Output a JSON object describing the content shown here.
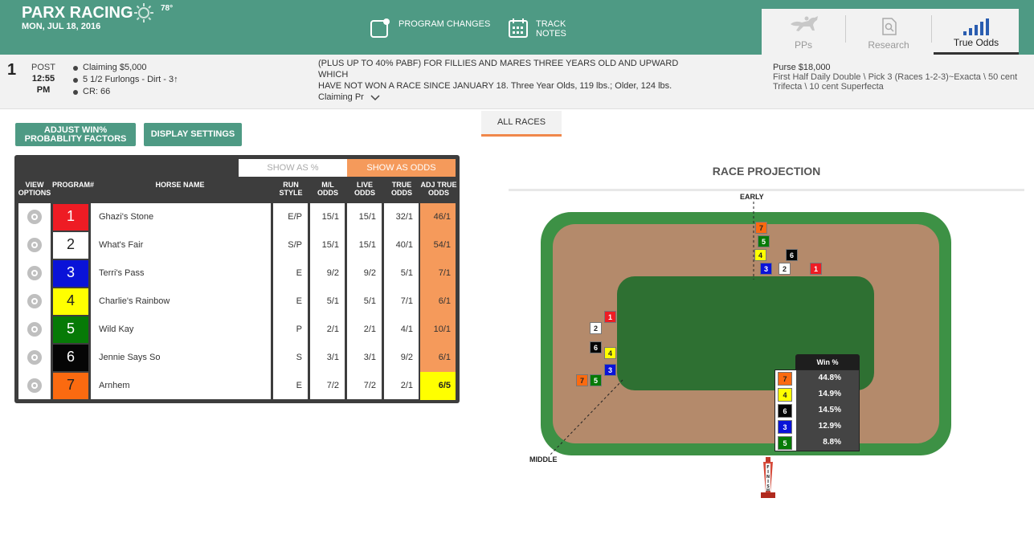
{
  "header": {
    "track": "PARX RACING",
    "date": "MON, JUL 18, 2016",
    "temperature": "78°",
    "weather_icon": "sun-icon",
    "program_changes": "PROGRAM CHANGES",
    "track_notes_1": "TRACK",
    "track_notes_2": "NOTES",
    "tabs": [
      {
        "label": "PPs",
        "icon": "horse-icon"
      },
      {
        "label": "Research",
        "icon": "document-icon"
      },
      {
        "label": "True Odds",
        "icon": "bar-chart-icon",
        "active": true
      }
    ]
  },
  "race": {
    "number": "1",
    "post_label": "POST",
    "post_time": "12:55",
    "post_ampm": "PM",
    "conditions": [
      "Claiming $5,000",
      "5 1/2 Furlongs - Dirt - 3↑",
      "CR: 66"
    ],
    "description_1": "(PLUS UP TO 40% PABF) FOR FILLIES AND MARES THREE YEARS OLD AND UPWARD WHICH",
    "description_2": "HAVE NOT WON A RACE SINCE JANUARY 18. Three Year Olds, 119 lbs.; Older, 124 lbs.",
    "description_3": "Claiming Pr",
    "purse": "Purse $18,000",
    "wagers_1": "First Half Daily Double \\ Pick 3 (Races 1-2-3)~Exacta \\ 50 cent",
    "wagers_2": "Trifecta \\ 10 cent Superfecta"
  },
  "controls": {
    "adjust_1": "ADJUST WIN%",
    "adjust_2": "PROBABLITY FACTORS",
    "display_settings": "DISPLAY SETTINGS",
    "all_races": "ALL RACES",
    "show_pct": "SHOW AS %",
    "show_odds": "SHOW AS ODDS"
  },
  "columns": {
    "view_1": "VIEW",
    "view_2": "OPTIONS",
    "program": "PROGRAM#",
    "horse": "HORSE NAME",
    "run_1": "RUN",
    "run_2": "STYLE",
    "ml_1": "M/L",
    "ml_2": "ODDS",
    "live_1": "LIVE",
    "live_2": "ODDS",
    "true_1": "TRUE",
    "true_2": "ODDS",
    "adj_1": "ADJ TRUE",
    "adj_2": "ODDS"
  },
  "horses": [
    {
      "pp": "1",
      "name": "Ghazi's Stone",
      "style": "E/P",
      "ml": "15/1",
      "live": "15/1",
      "true": "32/1",
      "adj": "46/1",
      "bg": "#ee1c24",
      "fg": "#ffffff"
    },
    {
      "pp": "2",
      "name": "What's Fair",
      "style": "S/P",
      "ml": "15/1",
      "live": "15/1",
      "true": "40/1",
      "adj": "54/1",
      "bg": "#ffffff",
      "fg": "#222222"
    },
    {
      "pp": "3",
      "name": "Terri's Pass",
      "style": "E",
      "ml": "9/2",
      "live": "9/2",
      "true": "5/1",
      "adj": "7/1",
      "bg": "#0a13d8",
      "fg": "#ffffff"
    },
    {
      "pp": "4",
      "name": "Charlie's Rainbow",
      "style": "E",
      "ml": "5/1",
      "live": "5/1",
      "true": "7/1",
      "adj": "6/1",
      "bg": "#ffff00",
      "fg": "#222222"
    },
    {
      "pp": "5",
      "name": "Wild Kay",
      "style": "P",
      "ml": "2/1",
      "live": "2/1",
      "true": "4/1",
      "adj": "10/1",
      "bg": "#067a06",
      "fg": "#ffffff"
    },
    {
      "pp": "6",
      "name": "Jennie Says So",
      "style": "S",
      "ml": "3/1",
      "live": "3/1",
      "true": "9/2",
      "adj": "6/1",
      "bg": "#050505",
      "fg": "#ffffff"
    },
    {
      "pp": "7",
      "name": "Arnhem",
      "style": "E",
      "ml": "7/2",
      "live": "7/2",
      "true": "2/1",
      "adj": "6/5",
      "bg": "#fb6a10",
      "fg": "#222222",
      "best": true
    }
  ],
  "projection": {
    "title": "RACE PROJECTION",
    "early": "EARLY",
    "middle": "MIDDLE",
    "finish": "FINISH",
    "win_header": "Win %",
    "win_table": [
      {
        "pp": "7",
        "pct": "44.8%"
      },
      {
        "pp": "4",
        "pct": "14.9%"
      },
      {
        "pp": "6",
        "pct": "14.5%"
      },
      {
        "pp": "3",
        "pct": "12.9%"
      },
      {
        "pp": "5",
        "pct": "8.8%"
      }
    ]
  }
}
